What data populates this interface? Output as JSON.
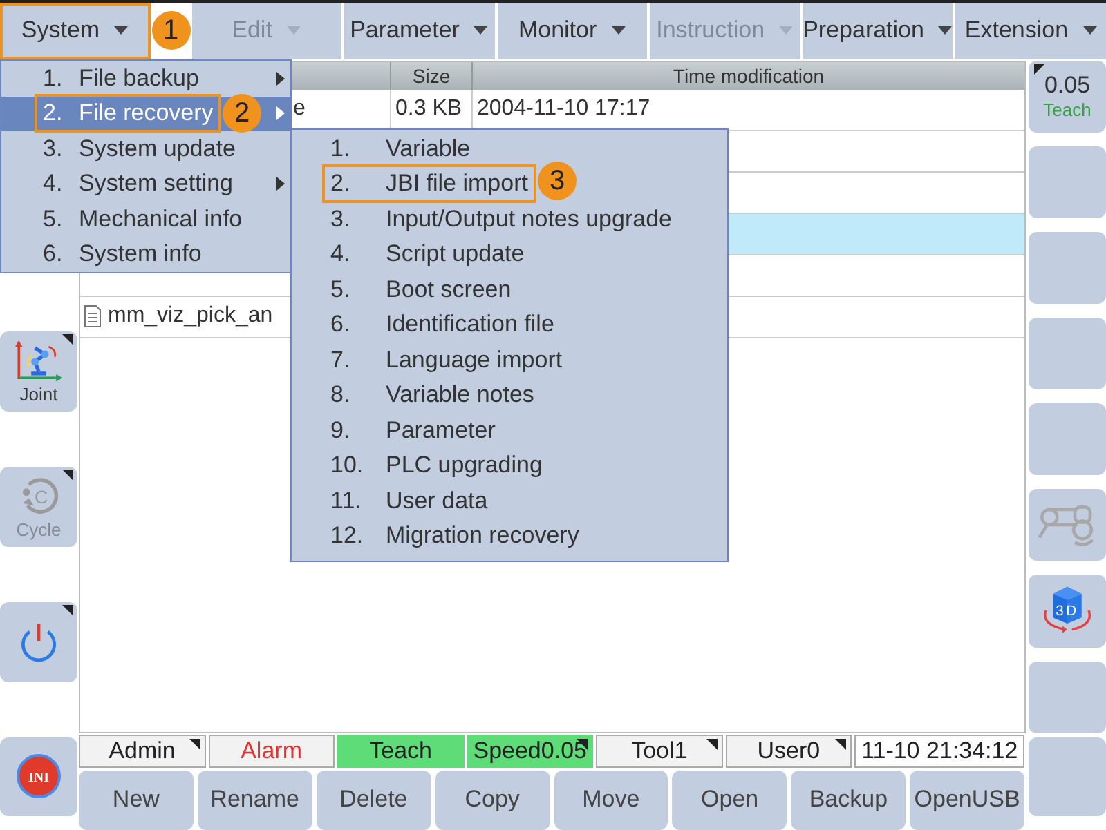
{
  "menubar": [
    {
      "label": "System",
      "disabled": false,
      "callout": "1"
    },
    {
      "label": "Edit",
      "disabled": true
    },
    {
      "label": "Parameter",
      "disabled": false
    },
    {
      "label": "Monitor",
      "disabled": false
    },
    {
      "label": "Instruction",
      "disabled": true
    },
    {
      "label": "Preparation",
      "disabled": false
    },
    {
      "label": "Extension",
      "disabled": false
    }
  ],
  "table": {
    "columns": [
      "Size",
      "Time modification"
    ],
    "rows": [
      {
        "name": "e",
        "icon": false,
        "clipped": true,
        "size": "0.3 KB",
        "time": "2004-11-10 17:17",
        "selected": false
      },
      {
        "selected": false
      },
      {
        "selected": false
      },
      {
        "selected": true
      },
      {
        "selected": false
      },
      {
        "name": "mm_viz_pick_an",
        "icon": true,
        "clipped": false,
        "selected": false
      }
    ]
  },
  "left_buttons": [
    {
      "kind": "joint",
      "label": "Joint",
      "disabled": false,
      "corner": true
    },
    {
      "kind": "cycle",
      "label": "Cycle",
      "icon_text": "C",
      "disabled": true,
      "corner": true
    },
    {
      "kind": "power",
      "disabled": false,
      "corner": true
    }
  ],
  "ini_button": {
    "icon_text": "INI"
  },
  "right_buttons": [
    {
      "kind": "speed",
      "value": "0.05",
      "label": "Teach",
      "corner": true
    },
    {
      "kind": "blank"
    },
    {
      "kind": "blank"
    },
    {
      "kind": "blank"
    },
    {
      "kind": "blank"
    },
    {
      "kind": "arm",
      "disabled": true
    },
    {
      "kind": "cube",
      "icon_text": "3D"
    },
    {
      "kind": "blank"
    }
  ],
  "status_bar": [
    {
      "text": "Admin",
      "kind": "plain",
      "corner": true
    },
    {
      "text": "Alarm",
      "kind": "alarm",
      "corner": false
    },
    {
      "text": "Teach",
      "kind": "active",
      "corner": false
    },
    {
      "text": "Speed0.05",
      "kind": "active",
      "corner": true
    },
    {
      "text": "Tool1",
      "kind": "plain",
      "corner": true
    },
    {
      "text": "User0",
      "kind": "plain",
      "corner": true
    },
    {
      "text": "11-10 21:34:12",
      "kind": "clock",
      "corner": false
    }
  ],
  "buttons": [
    "New",
    "Rename",
    "Delete",
    "Copy",
    "Move",
    "Open",
    "Backup",
    "OpenUSB"
  ],
  "system_menu": [
    {
      "number": "1.",
      "label": "File backup",
      "submenu": true,
      "selected": false
    },
    {
      "number": "2.",
      "label": "File recovery",
      "submenu": true,
      "selected": true,
      "callout": "2"
    },
    {
      "number": "3.",
      "label": "System update",
      "submenu": false,
      "selected": false
    },
    {
      "number": "4.",
      "label": "System setting",
      "submenu": true,
      "selected": false
    },
    {
      "number": "5.",
      "label": "Mechanical info",
      "submenu": false,
      "selected": false
    },
    {
      "number": "6.",
      "label": "System info",
      "submenu": false,
      "selected": false
    }
  ],
  "recovery_menu": [
    {
      "number": "1.",
      "label": "Variable"
    },
    {
      "number": "2.",
      "label": "JBI file import",
      "callout": "3"
    },
    {
      "number": "3.",
      "label": "Input/Output notes upgrade"
    },
    {
      "number": "4.",
      "label": "Script update"
    },
    {
      "number": "5.",
      "label": "Boot screen"
    },
    {
      "number": "6.",
      "label": "Identification file"
    },
    {
      "number": "7.",
      "label": "Language import"
    },
    {
      "number": "8.",
      "label": "Variable notes"
    },
    {
      "number": "9.",
      "label": "Parameter"
    },
    {
      "number": "10.",
      "label": "PLC upgrading"
    },
    {
      "number": "11.",
      "label": "User data"
    },
    {
      "number": "12.",
      "label": "Migration recovery"
    }
  ]
}
